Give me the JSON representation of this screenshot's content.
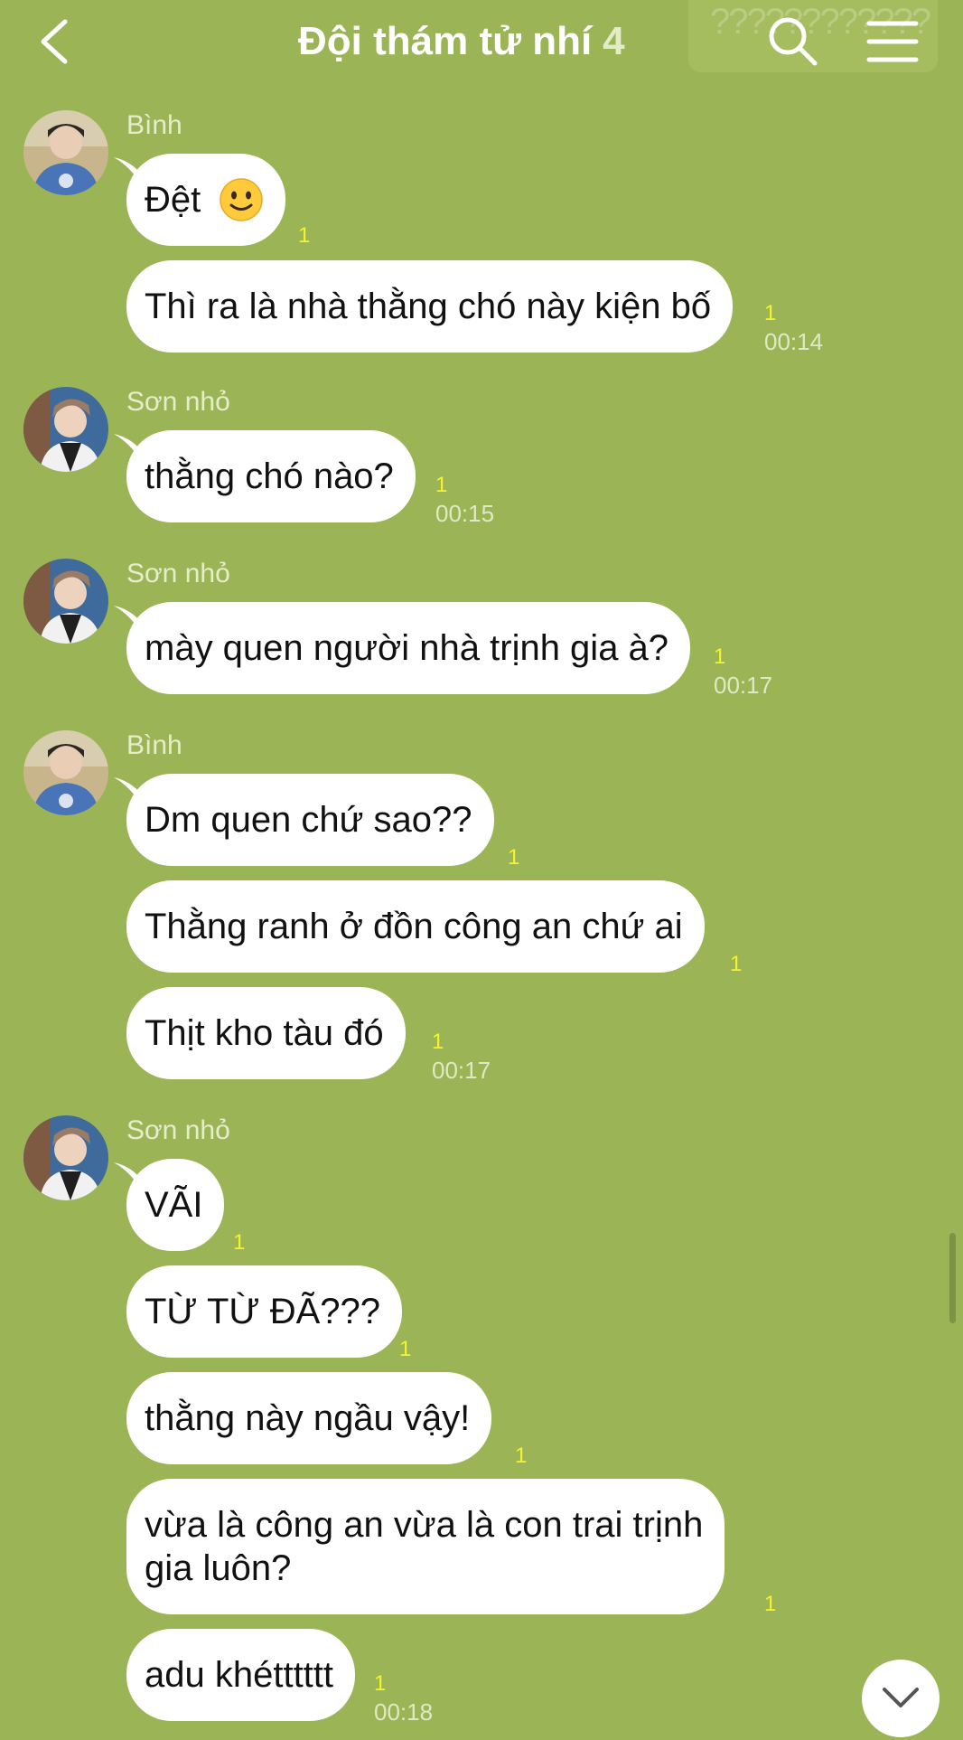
{
  "header": {
    "title": "Đội thám tử nhí",
    "member_count": "4",
    "overlay_text": "????????????"
  },
  "senders": {
    "binh": "Bình",
    "son": "Sơn nhỏ"
  },
  "messages": [
    {
      "text": "Đệt",
      "read": "1",
      "time": ""
    },
    {
      "text": "Thì ra là nhà thằng chó này kiện bố",
      "read": "1",
      "time": "00:14"
    },
    {
      "text": "thằng chó nào?",
      "read": "1",
      "time": "00:15"
    },
    {
      "text": "mày quen người nhà trịnh gia à?",
      "read": "1",
      "time": "00:17"
    },
    {
      "text": "Dm quen chứ sao??",
      "read": "1",
      "time": ""
    },
    {
      "text": "Thằng ranh ở đồn công an chứ ai",
      "read": "1",
      "time": ""
    },
    {
      "text": "Thịt kho tàu đó",
      "read": "1",
      "time": "00:17"
    },
    {
      "text": "VÃI",
      "read": "1",
      "time": ""
    },
    {
      "text": "TỪ TỪ ĐÃ???",
      "read": "1",
      "time": ""
    },
    {
      "text": "thằng này ngầu vậy!",
      "read": "1",
      "time": ""
    },
    {
      "line1": "vừa là công an vừa là con trai trịnh",
      "line2": "gia luôn?",
      "read": "1",
      "time": ""
    },
    {
      "text": "adu khétttttt",
      "read": "1",
      "time": "00:18"
    }
  ],
  "colors": {
    "background": "#9bb556",
    "bubble": "#ffffff",
    "read_indicator": "#f7f22e",
    "text": "#111111"
  },
  "icons": {
    "back": "chevron-left-icon",
    "search": "search-icon",
    "menu": "hamburger-menu-icon",
    "scroll_down": "chevron-down-icon",
    "emoji": "slightly-smiling-face-emoji"
  }
}
